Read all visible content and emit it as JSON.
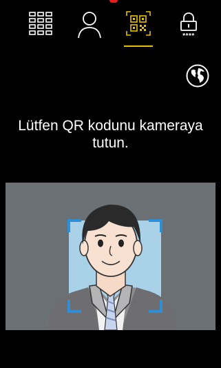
{
  "tabs": [
    {
      "id": "keypad",
      "icon": "keypad-icon",
      "active": false
    },
    {
      "id": "face",
      "icon": "user-icon",
      "active": false
    },
    {
      "id": "qr",
      "icon": "qr-code-icon",
      "active": true
    },
    {
      "id": "pin",
      "icon": "lock-pin-icon",
      "active": false,
      "label": "****"
    }
  ],
  "language_button": {
    "icon": "globe-icon"
  },
  "prompt": {
    "text": "Lütfen QR kodunu kameraya tutun."
  },
  "colors": {
    "background": "#000000",
    "accent": "#e8c400",
    "frame": "#2e8fd6",
    "camera_bg": "#6a7074"
  }
}
